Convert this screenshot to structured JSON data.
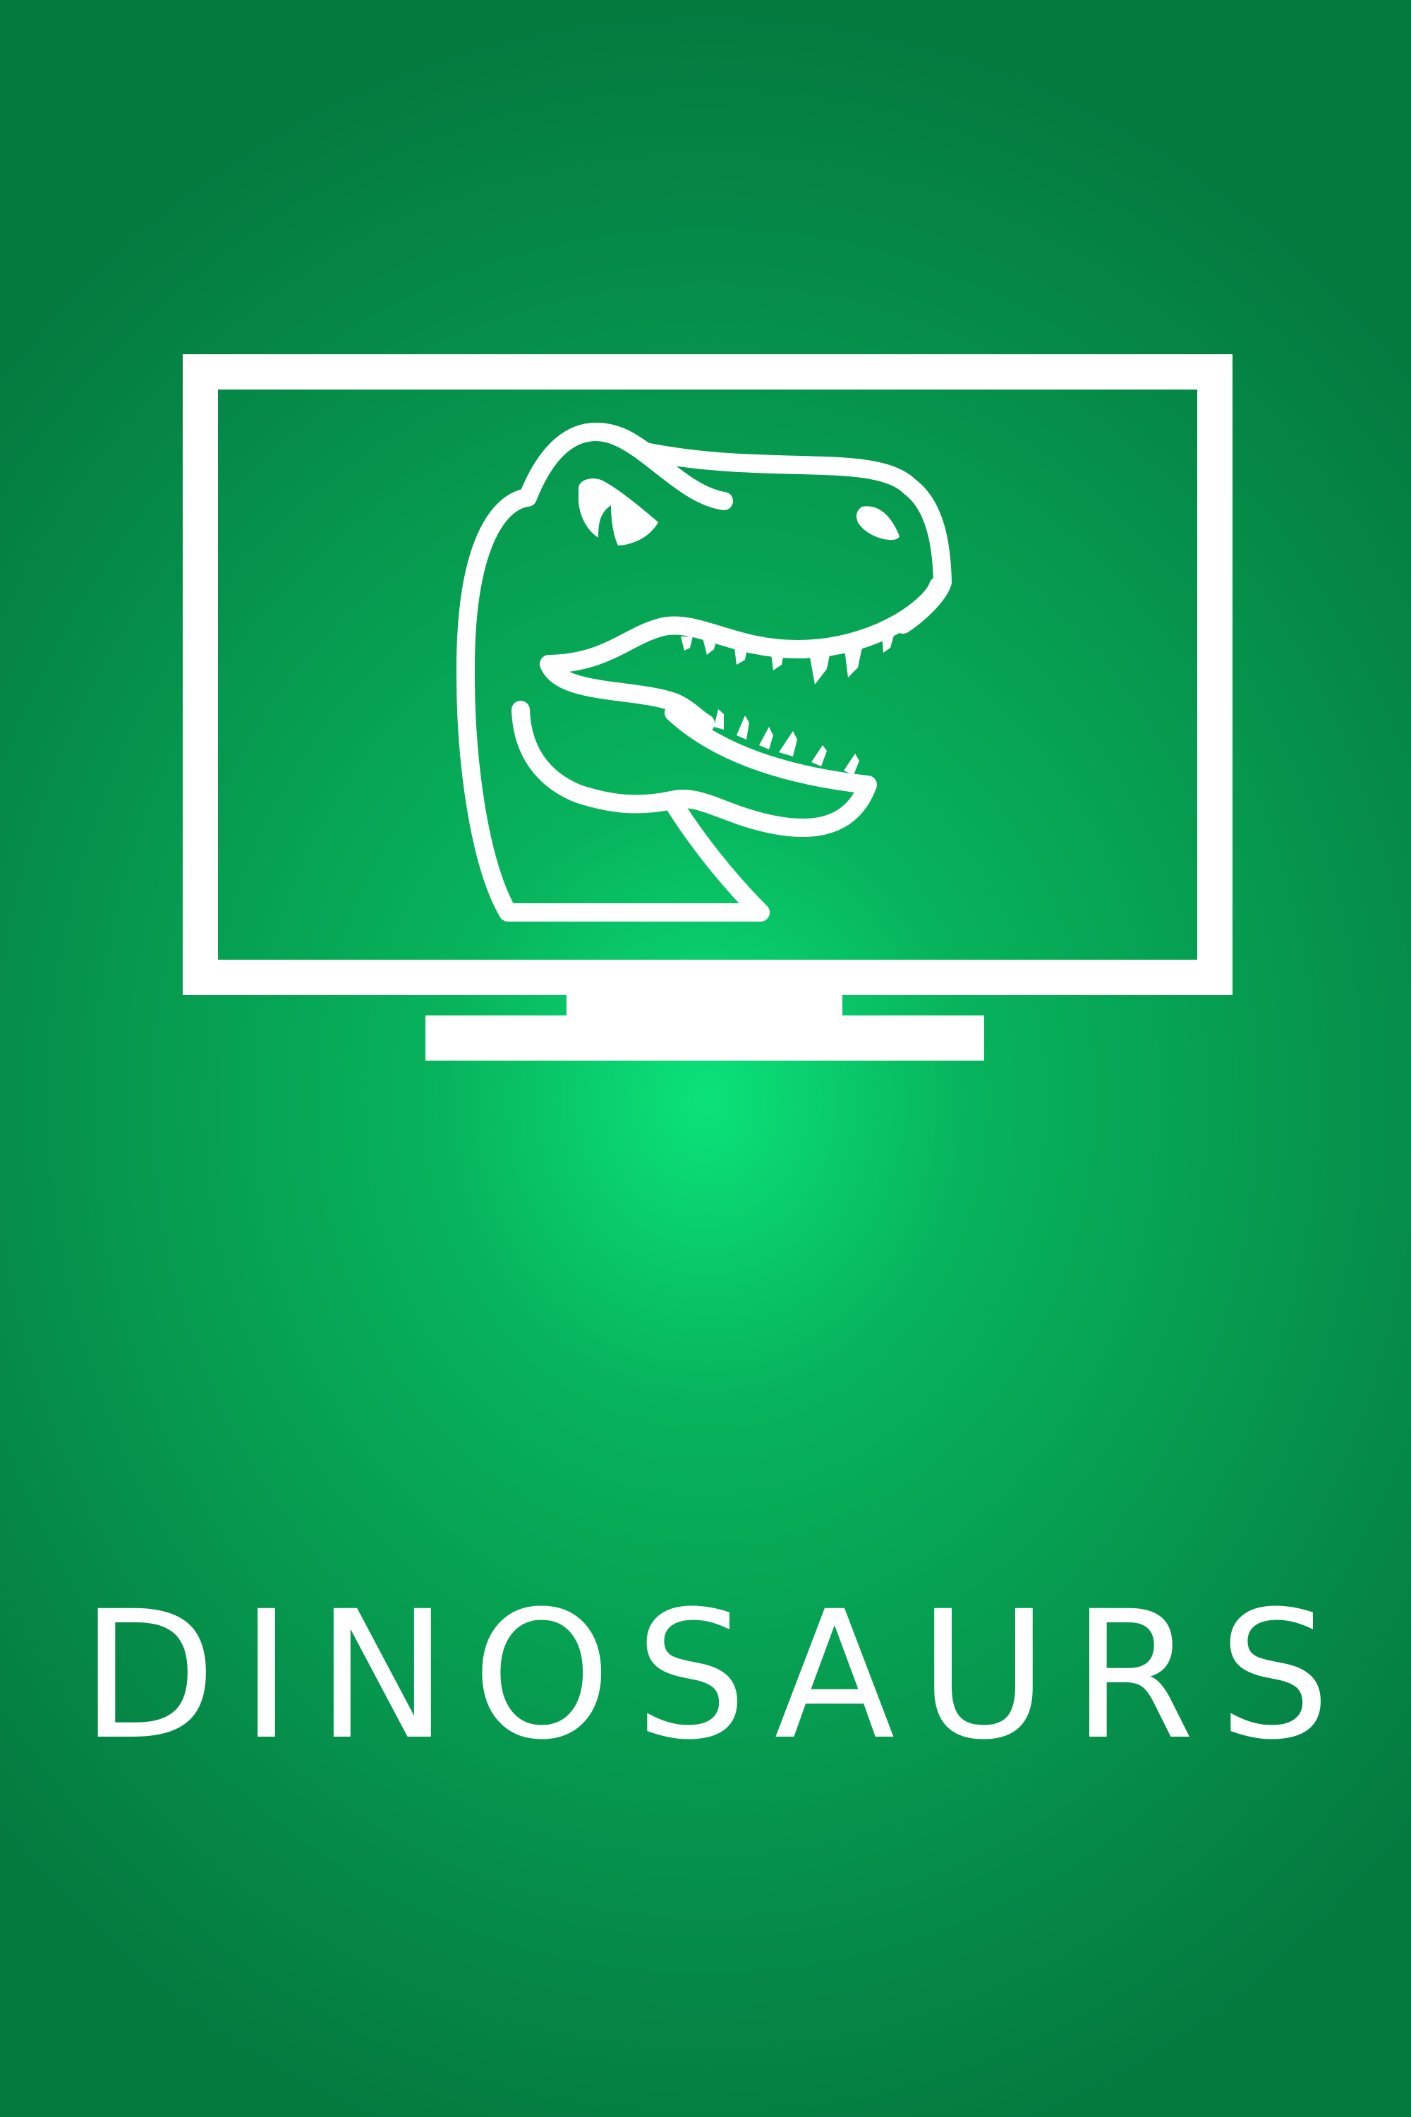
{
  "tile": {
    "title": "DINOSAURS",
    "icon": "tv-dinosaur-icon",
    "colors": {
      "background_center": "#0be27a",
      "background_edge": "#047a3f",
      "foreground": "#ffffff"
    }
  }
}
